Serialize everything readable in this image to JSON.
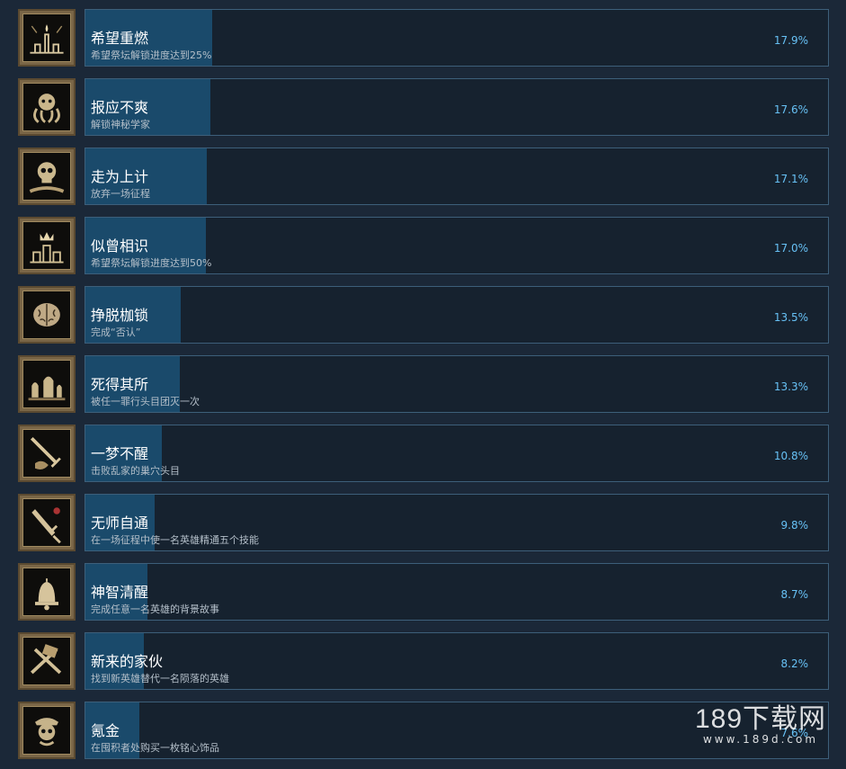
{
  "achievements": [
    {
      "title": "希望重燃",
      "desc": "希望祭坛解锁进度达到25%",
      "percent": "17.9%",
      "fill": 17.9,
      "icon": "candle-altar-icon"
    },
    {
      "title": "报应不爽",
      "desc": "解锁神秘学家",
      "percent": "17.6%",
      "fill": 17.6,
      "icon": "tentacle-face-icon"
    },
    {
      "title": "走为上计",
      "desc": "放弃一场征程",
      "percent": "17.1%",
      "fill": 17.1,
      "icon": "skull-bones-icon"
    },
    {
      "title": "似曾相识",
      "desc": "希望祭坛解锁进度达到50%",
      "percent": "17.0%",
      "fill": 17.0,
      "icon": "crown-altar-icon"
    },
    {
      "title": "挣脱枷锁",
      "desc": "完成“否认”",
      "percent": "13.5%",
      "fill": 13.5,
      "icon": "brain-icon"
    },
    {
      "title": "死得其所",
      "desc": "被任一罪行头目团灭一次",
      "percent": "13.3%",
      "fill": 13.3,
      "icon": "gravestones-icon"
    },
    {
      "title": "一梦不醒",
      "desc": "击败乱家的巢穴头目",
      "percent": "10.8%",
      "fill": 10.8,
      "icon": "sword-hand-icon"
    },
    {
      "title": "无师自通",
      "desc": "在一场征程中使一名英雄精通五个技能",
      "percent": "9.8%",
      "fill": 9.8,
      "icon": "dagger-icon"
    },
    {
      "title": "神智清醒",
      "desc": "完成任意一名英雄的背景故事",
      "percent": "8.7%",
      "fill": 8.7,
      "icon": "bell-icon"
    },
    {
      "title": "新来的家伙",
      "desc": "找到新英雄替代一名陨落的英雄",
      "percent": "8.2%",
      "fill": 8.2,
      "icon": "crossed-weapons-icon"
    },
    {
      "title": "氪金",
      "desc": "在囤积者处购买一枚铭心饰品",
      "percent": "7.6%",
      "fill": 7.6,
      "icon": "pirate-skull-icon"
    }
  ],
  "watermark": {
    "main": "189下载网",
    "sub": "www.189d.com"
  }
}
